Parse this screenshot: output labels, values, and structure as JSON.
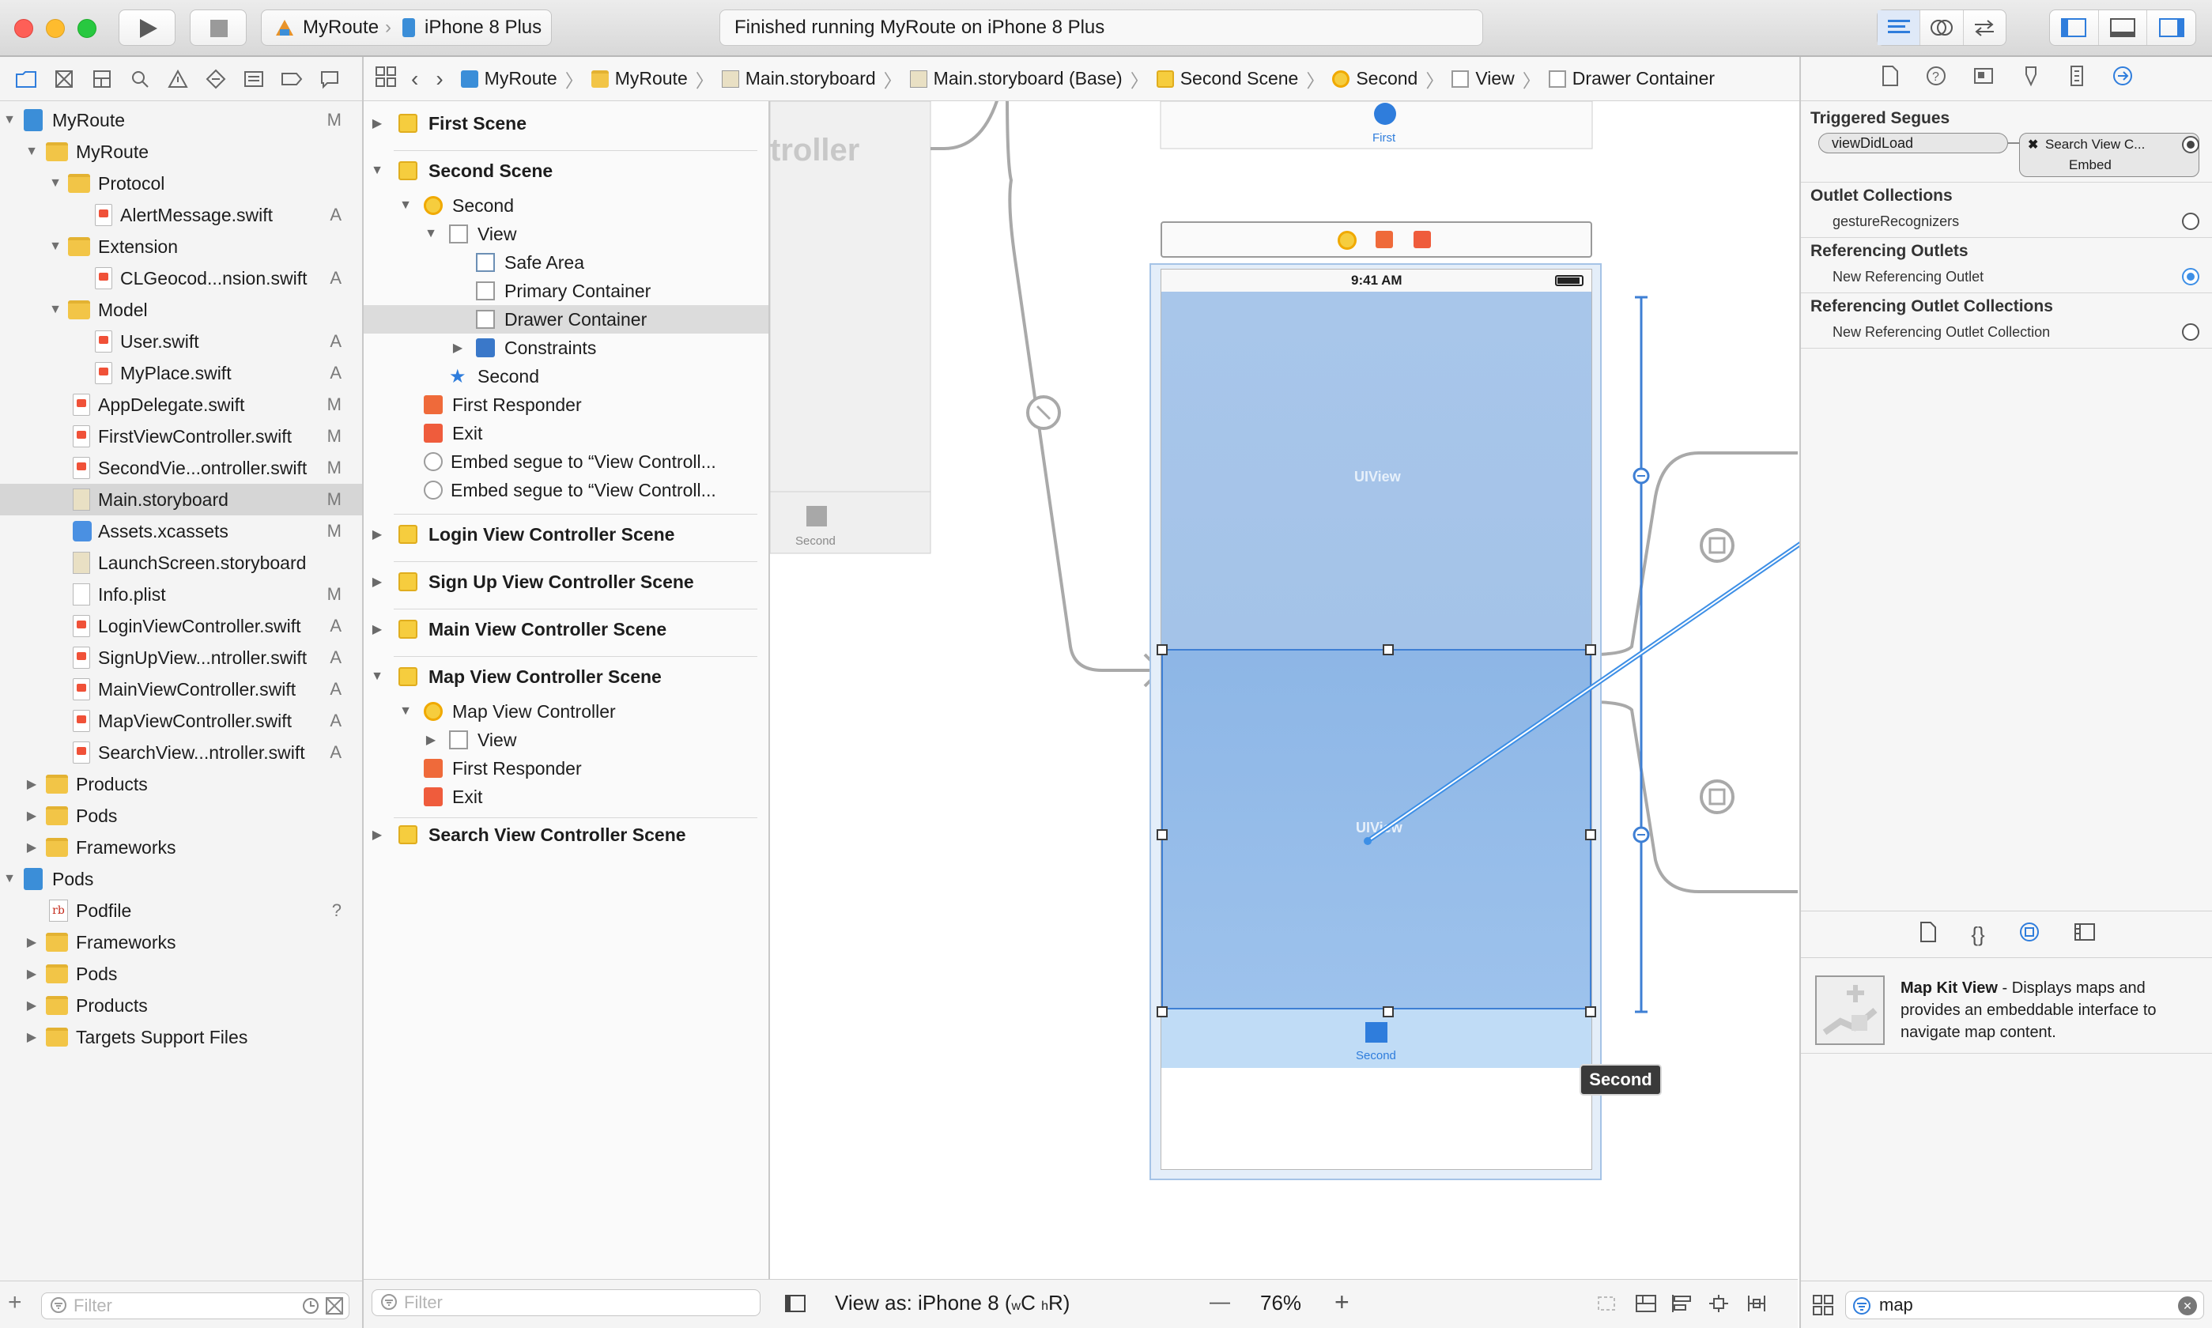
{
  "toolbar": {
    "scheme_target": "MyRoute",
    "scheme_device": "iPhone 8 Plus",
    "status": "Finished running MyRoute on iPhone 8 Plus"
  },
  "navigator": {
    "items": [
      {
        "label": "MyRoute",
        "status": "M"
      },
      {
        "label": "MyRoute",
        "status": ""
      },
      {
        "label": "Protocol",
        "status": ""
      },
      {
        "label": "AlertMessage.swift",
        "status": "A"
      },
      {
        "label": "Extension",
        "status": ""
      },
      {
        "label": "CLGeocod...nsion.swift",
        "status": "A"
      },
      {
        "label": "Model",
        "status": ""
      },
      {
        "label": "User.swift",
        "status": "A"
      },
      {
        "label": "MyPlace.swift",
        "status": "A"
      },
      {
        "label": "AppDelegate.swift",
        "status": "M"
      },
      {
        "label": "FirstViewController.swift",
        "status": "M"
      },
      {
        "label": "SecondVie...ontroller.swift",
        "status": "M"
      },
      {
        "label": "Main.storyboard",
        "status": "M"
      },
      {
        "label": "Assets.xcassets",
        "status": "M"
      },
      {
        "label": "LaunchScreen.storyboard",
        "status": ""
      },
      {
        "label": "Info.plist",
        "status": "M"
      },
      {
        "label": "LoginViewController.swift",
        "status": "A"
      },
      {
        "label": "SignUpView...ntroller.swift",
        "status": "A"
      },
      {
        "label": "MainViewController.swift",
        "status": "A"
      },
      {
        "label": "MapViewController.swift",
        "status": "A"
      },
      {
        "label": "SearchView...ntroller.swift",
        "status": "A"
      },
      {
        "label": "Products",
        "status": ""
      },
      {
        "label": "Pods",
        "status": ""
      },
      {
        "label": "Frameworks",
        "status": ""
      },
      {
        "label": "Pods",
        "status": ""
      },
      {
        "label": "Podfile",
        "status": "?"
      },
      {
        "label": "Frameworks",
        "status": ""
      },
      {
        "label": "Pods",
        "status": ""
      },
      {
        "label": "Products",
        "status": ""
      },
      {
        "label": "Targets Support Files",
        "status": ""
      }
    ],
    "filter_placeholder": "Filter"
  },
  "jumpbar": [
    "MyRoute",
    "MyRoute",
    "Main.storyboard",
    "Main.storyboard (Base)",
    "Second Scene",
    "Second",
    "View",
    "Drawer Container"
  ],
  "outline": {
    "items": [
      {
        "label": "First Scene"
      },
      {
        "label": "Second Scene"
      },
      {
        "label": "Second"
      },
      {
        "label": "View"
      },
      {
        "label": "Safe Area"
      },
      {
        "label": "Primary Container"
      },
      {
        "label": "Drawer Container"
      },
      {
        "label": "Constraints"
      },
      {
        "label": "Second"
      },
      {
        "label": "First Responder"
      },
      {
        "label": "Exit"
      },
      {
        "label": "Embed segue to “View Controll..."
      },
      {
        "label": "Embed segue to “View Controll..."
      },
      {
        "label": "Login View Controller Scene"
      },
      {
        "label": "Sign Up View Controller Scene"
      },
      {
        "label": "Main View Controller Scene"
      },
      {
        "label": "Map View Controller Scene"
      },
      {
        "label": "Map View Controller"
      },
      {
        "label": "View"
      },
      {
        "label": "First Responder"
      },
      {
        "label": "Exit"
      },
      {
        "label": "Search View Controller Scene"
      }
    ],
    "filter_placeholder": "Filter"
  },
  "canvas": {
    "left_scene_title": "troller",
    "left_tab_label": "Second",
    "top_tab_label": "First",
    "status_time": "9:41 AM",
    "primary_view_label": "UIView",
    "drawer_view_label": "UIView",
    "bottom_tab_label": "Second",
    "scene_badge": "Second",
    "view_as": "View as: iPhone 8 (",
    "view_as_w": "w",
    "view_as_c": "C",
    "view_as_h": "h",
    "view_as_r": "R)",
    "zoom": "76%",
    "zoom_out": "—",
    "zoom_in": "+"
  },
  "inspector": {
    "triggered_segues_title": "Triggered Segues",
    "segue_name": "viewDidLoad",
    "segue_target_line1": "Search View C...",
    "segue_target_line2": "Embed",
    "outlet_collections_title": "Outlet Collections",
    "outlet_collection_item": "gestureRecognizers",
    "referencing_outlets_title": "Referencing Outlets",
    "referencing_outlet_item": "New Referencing Outlet",
    "referencing_outlet_collections_title": "Referencing Outlet Collections",
    "referencing_outlet_collection_item": "New Referencing Outlet Collection",
    "library_item_title": "Map Kit View",
    "library_item_desc": " - Displays maps and provides an embeddable interface to navigate map content.",
    "search_value": "map"
  },
  "colors": {
    "accent": "#2f7ddc",
    "highlight_ring": "#27d0e8",
    "view_fill": "#a9c8ea",
    "folder": "#f2c547"
  }
}
